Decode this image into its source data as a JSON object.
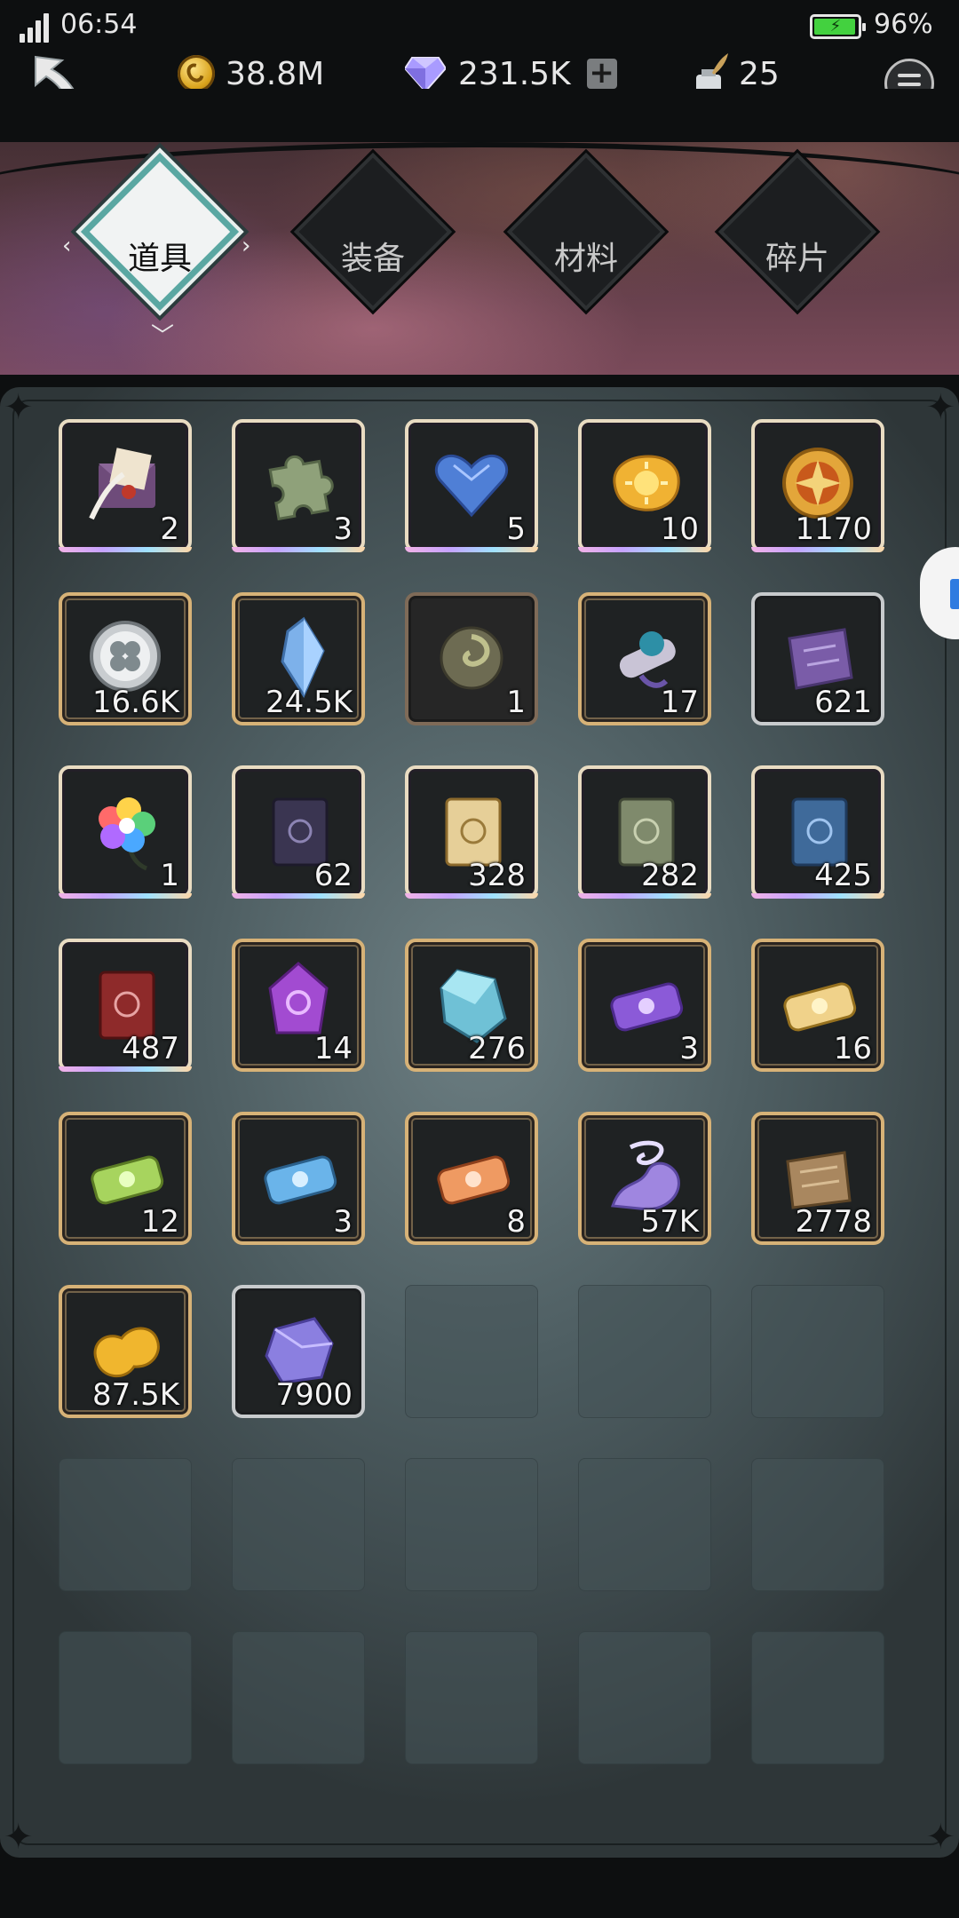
{
  "status_bar": {
    "time": "06:54",
    "battery_pct": "96%",
    "battery_level": 0.96,
    "charging": true
  },
  "resources": {
    "gold": "38.8M",
    "diamonds": "231.5K",
    "ink": "25"
  },
  "tabs": [
    {
      "label": "道具",
      "active": true
    },
    {
      "label": "装备",
      "active": false
    },
    {
      "label": "材料",
      "active": false
    },
    {
      "label": "碎片",
      "active": false
    }
  ],
  "inventory": [
    {
      "icon": "letter-quill-icon",
      "qty": "2",
      "frame": "holo"
    },
    {
      "icon": "puzzle-piece-icon",
      "qty": "3",
      "frame": "holo"
    },
    {
      "icon": "blue-heart-gem-icon",
      "qty": "5",
      "frame": "holo"
    },
    {
      "icon": "sun-stone-icon",
      "qty": "10",
      "frame": "holo"
    },
    {
      "icon": "golden-medal-icon",
      "qty": "1170",
      "frame": "holo"
    },
    {
      "icon": "clover-coin-icon",
      "qty": "16.6K",
      "frame": "gold"
    },
    {
      "icon": "blue-crystal-icon",
      "qty": "24.5K",
      "frame": "gold"
    },
    {
      "icon": "swirl-orb-icon",
      "qty": "1",
      "frame": "bronze"
    },
    {
      "icon": "sealed-scroll-icon",
      "qty": "17",
      "frame": "gold"
    },
    {
      "icon": "purple-map-scroll-icon",
      "qty": "621",
      "frame": "silver"
    },
    {
      "icon": "rainbow-flower-icon",
      "qty": "1",
      "frame": "holo"
    },
    {
      "icon": "dark-tome-icon",
      "qty": "62",
      "frame": "holo"
    },
    {
      "icon": "golden-tome-icon",
      "qty": "328",
      "frame": "holo"
    },
    {
      "icon": "green-tome-icon",
      "qty": "282",
      "frame": "holo"
    },
    {
      "icon": "blue-tome-icon",
      "qty": "425",
      "frame": "holo"
    },
    {
      "icon": "red-tome-icon",
      "qty": "487",
      "frame": "holo"
    },
    {
      "icon": "purple-rune-gem-icon",
      "qty": "14",
      "frame": "gold"
    },
    {
      "icon": "prism-crystal-icon",
      "qty": "276",
      "frame": "gold"
    },
    {
      "icon": "purple-scroll-icon",
      "qty": "3",
      "frame": "gold"
    },
    {
      "icon": "gold-scroll-icon",
      "qty": "16",
      "frame": "gold"
    },
    {
      "icon": "green-scroll-icon",
      "qty": "12",
      "frame": "gold"
    },
    {
      "icon": "blue-scroll-icon",
      "qty": "3",
      "frame": "gold"
    },
    {
      "icon": "orange-scroll-icon",
      "qty": "8",
      "frame": "gold"
    },
    {
      "icon": "purple-dust-icon",
      "qty": "57K",
      "frame": "gold"
    },
    {
      "icon": "old-parchment-icon",
      "qty": "2778",
      "frame": "gold"
    },
    {
      "icon": "gold-nugget-icon",
      "qty": "87.5K",
      "frame": "gold"
    },
    {
      "icon": "violet-stone-icon",
      "qty": "7900",
      "frame": "silver"
    }
  ],
  "empty_slots": 13,
  "colors": {
    "panel": "#5c6d71",
    "gold_frame": "#d7b277",
    "active_tab_ring": "#5aa7a2",
    "battery_green": "#43d13f"
  }
}
